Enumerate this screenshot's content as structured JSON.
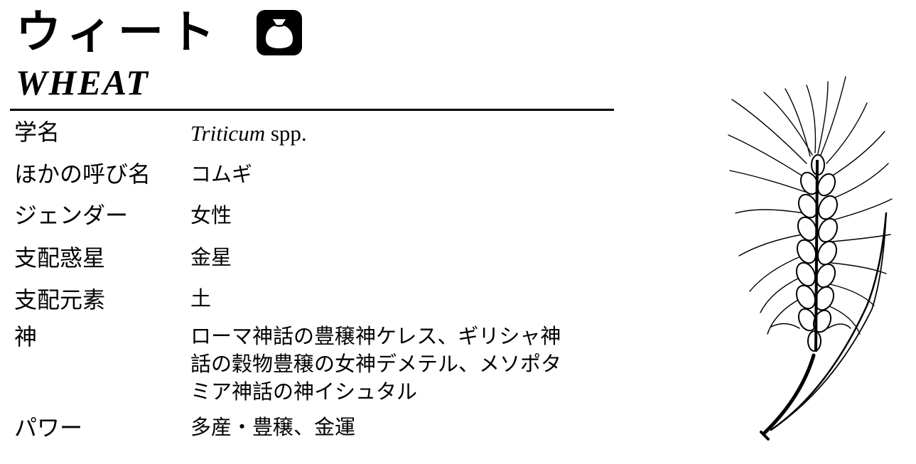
{
  "header": {
    "title_ja": "ウィート",
    "title_en": "WHEAT",
    "category_icon": "seed-bag-icon"
  },
  "fields": {
    "scientific_name": {
      "label": "学名",
      "genus": "Triticum",
      "suffix": " spp."
    },
    "other_names": {
      "label": "ほかの呼び名",
      "value": "コムギ"
    },
    "gender": {
      "label": "ジェンダー",
      "value": "女性"
    },
    "planet": {
      "label": "支配惑星",
      "value": "金星"
    },
    "element": {
      "label": "支配元素",
      "value": "土"
    },
    "deities": {
      "label": "神",
      "lines": [
        "ローマ神話の豊穣神ケレス、ギリシャ神",
        "話の穀物豊穣の女神デメテル、メソポタ",
        "ミア神話の神イシュタル"
      ]
    },
    "powers": {
      "label": "パワー",
      "value": "多産・豊穣、金運"
    }
  },
  "illustration": {
    "icon": "wheat-ear-illustration"
  }
}
